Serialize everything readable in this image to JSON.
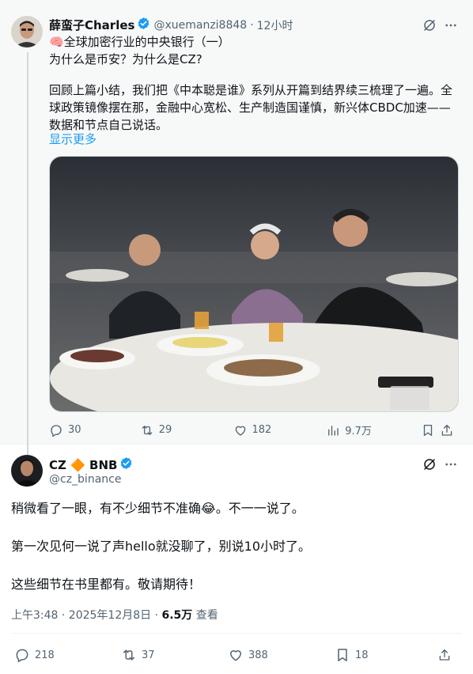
{
  "quoted_post": {
    "author_name": "薛蛮子Charles",
    "author_handle": "@xuemanzi8848",
    "dot": "·",
    "time": "12小时",
    "title_line": "🧠全球加密行业的中央银行（一）",
    "subtitle_line": "为什么是币安？为什么是CZ?",
    "body_line_1": "回顾上篇小结，我们把《中本聪是谁》系列从开篇到结界续三梳理了一遍。全",
    "body_line_2": "球政策镜像摆在那，金融中心宽松、生产制造国谨慎，新兴体CBDC加速——",
    "body_line_3": "数据和节点自己说话。",
    "show_more": "显示更多",
    "stats": {
      "replies": "30",
      "reposts": "29",
      "likes": "182",
      "views": "9.7万"
    }
  },
  "main_post": {
    "author_name": "CZ 🔶 BNB",
    "author_handle": "@cz_binance",
    "line_1": "稍微看了一眼，有不少细节不准确😂。不一一说了。",
    "line_2": "第一次见何一说了声hello就没聊了，别说10小时了。",
    "line_3": "这些细节在书里都有。敬请期待！",
    "timestamp": "上午3:48 · 2025年12月8日 · ",
    "views_count": "6.5万",
    "views_label": " 查看",
    "stats": {
      "replies": "218",
      "reposts": "37",
      "likes": "388",
      "bookmarks": "18"
    }
  },
  "colors": {
    "link": "#1d9bf0",
    "verified": "#1d9bf0",
    "muted": "#536471",
    "background_quoted": "#f7f9f9"
  },
  "icons": [
    "verified-badge-icon",
    "grok-icon",
    "more-icon",
    "reply-icon",
    "repost-icon",
    "like-icon",
    "views-icon",
    "bookmark-icon",
    "share-icon"
  ]
}
